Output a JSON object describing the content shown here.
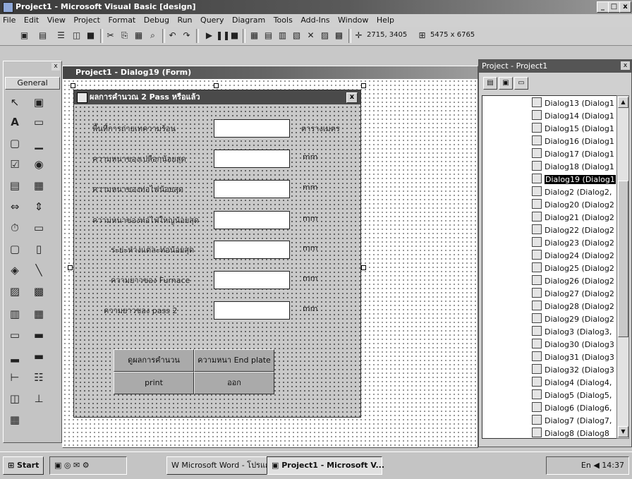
{
  "window": {
    "title": "Project1 - Microsoft Visual Basic [design]",
    "min": "_",
    "max": "□",
    "close": "x"
  },
  "menu": [
    "File",
    "Edit",
    "View",
    "Project",
    "Format",
    "Debug",
    "Run",
    "Query",
    "Diagram",
    "Tools",
    "Add-Ins",
    "Window",
    "Help"
  ],
  "toolbar": {
    "position_readout": "2715, 3405",
    "size_readout": "5475 x 6765"
  },
  "toolbox": {
    "close": "x",
    "tab": "General"
  },
  "designer": {
    "title": "Project1 - Dialog19 (Form)"
  },
  "form": {
    "title": "ผลการคำนวณ 2 Pass หรือแล้ว",
    "close": "x",
    "fields": [
      {
        "label": "พื้นที่การถ่ายเทความร้อน",
        "unit": "ตารางเมตร"
      },
      {
        "label": "ความหนาของเปลือกน้อยสุด",
        "unit": "mm"
      },
      {
        "label": "ความหนาของท่อไฟน้อยสุด",
        "unit": "mm"
      },
      {
        "label": "ความหนาของท่อไฟใหญ่น้อยสุด",
        "unit": "mm"
      },
      {
        "label": "ระยะห่างแต่ละท่อน้อยสุด",
        "unit": "mm"
      },
      {
        "label": "ความยาวของ Furnace",
        "unit": "mm"
      },
      {
        "label": "ความยาวของ pass 2",
        "unit": "mm"
      }
    ],
    "buttons": {
      "result": "ดูผลการคำนวน",
      "endplate": "ความหนา End plate",
      "print": "print",
      "exit": "ออก"
    }
  },
  "project": {
    "title": "Project - Project1",
    "close": "x",
    "items": [
      "Dialog13 (Dialog1",
      "Dialog14 (Dialog1",
      "Dialog15 (Dialog1",
      "Dialog16 (Dialog1",
      "Dialog17 (Dialog1",
      "Dialog18 (Dialog1",
      "Dialog19 (Dialog1",
      "Dialog2 (Dialog2,",
      "Dialog20 (Dialog2",
      "Dialog21 (Dialog2",
      "Dialog22 (Dialog2",
      "Dialog23 (Dialog2",
      "Dialog24 (Dialog2",
      "Dialog25 (Dialog2",
      "Dialog26 (Dialog2",
      "Dialog27 (Dialog2",
      "Dialog28 (Dialog2",
      "Dialog29 (Dialog2",
      "Dialog3 (Dialog3,",
      "Dialog30 (Dialog3",
      "Dialog31 (Dialog3",
      "Dialog32 (Dialog3",
      "Dialog4 (Dialog4,",
      "Dialog5 (Dialog5,",
      "Dialog6 (Dialog6,",
      "Dialog7 (Dialog7,",
      "Dialog8 (Dialog8"
    ],
    "selected": "Dialog19 (Dialog1"
  },
  "taskbar": {
    "start": "Start",
    "tasks": [
      "Microsoft Word - โปรแกร...",
      "Project1 - Microsoft V..."
    ],
    "tray_lang": "En",
    "clock": "14:37"
  }
}
